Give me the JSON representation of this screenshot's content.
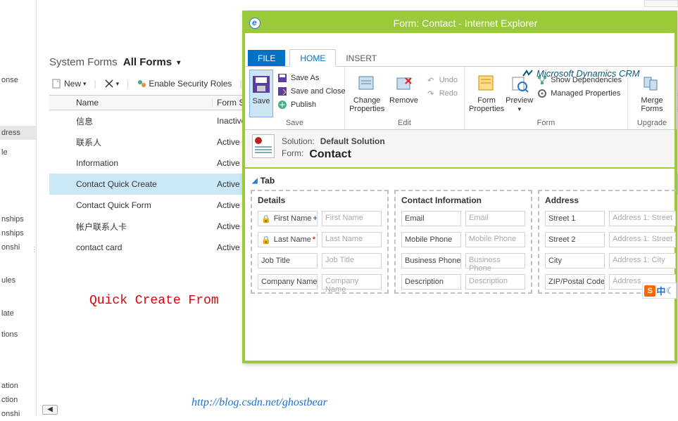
{
  "left_sidebar": {
    "items": [
      "onse",
      "dress",
      "le",
      "nships",
      "nships",
      "onshi",
      "ules",
      "late",
      "tions",
      "ation",
      "ction",
      "onshi"
    ]
  },
  "breadcrumb": {
    "label": "System Forms",
    "filter": "All Forms"
  },
  "toolbar": {
    "new_label": "New",
    "enable_security_label": "Enable Security Roles"
  },
  "grid": {
    "columns": {
      "name": "Name",
      "state": "Form S"
    },
    "rows": [
      {
        "name": "信息",
        "state": "Inactive"
      },
      {
        "name": "联系人",
        "state": "Active"
      },
      {
        "name": "Information",
        "state": "Active"
      },
      {
        "name": "Contact Quick Create",
        "state": "Active"
      },
      {
        "name": "Contact Quick Form",
        "state": "Active"
      },
      {
        "name": "帐户联系人卡",
        "state": "Active"
      },
      {
        "name": "contact card",
        "state": "Active"
      }
    ],
    "selected_index": 3
  },
  "annotation": "Quick Create From",
  "footer_link": "http://blog.csdn.net/ghostbear",
  "ie": {
    "title": "Form: Contact - Internet Explorer",
    "brand": "Microsoft Dynamics CRM",
    "tabs": {
      "file": "FILE",
      "home": "HOME",
      "insert": "INSERT"
    },
    "ribbon": {
      "save_group": "Save",
      "save": "Save",
      "save_as": "Save As",
      "save_close": "Save and Close",
      "publish": "Publish",
      "edit_group": "Edit",
      "change_props": "Change\nProperties",
      "remove": "Remove",
      "undo": "Undo",
      "redo": "Redo",
      "form_group": "Form",
      "form_props": "Form\nProperties",
      "preview": "Preview",
      "show_deps": "Show Dependencies",
      "managed_props": "Managed Properties",
      "upgrade_group": "Upgrade",
      "merge_forms": "Merge\nForms"
    },
    "info": {
      "solution_label": "Solution:",
      "solution_value": "Default Solution",
      "form_label": "Form:",
      "form_value": "Contact"
    },
    "form": {
      "tab_label": "Tab",
      "sections": [
        {
          "title": "Details",
          "fields": [
            {
              "label": "First Name",
              "lock": true,
              "plus": true,
              "placeholder": "First Name"
            },
            {
              "label": "Last Name",
              "lock": true,
              "star": true,
              "placeholder": "Last Name"
            },
            {
              "label": "Job Title",
              "placeholder": "Job Title"
            },
            {
              "label": "Company Name",
              "placeholder": "Company Name"
            }
          ]
        },
        {
          "title": "Contact Information",
          "fields": [
            {
              "label": "Email",
              "placeholder": "Email"
            },
            {
              "label": "Mobile Phone",
              "placeholder": "Mobile Phone"
            },
            {
              "label": "Business Phone",
              "placeholder": "Business Phone"
            },
            {
              "label": "Description",
              "placeholder": "Description"
            }
          ]
        },
        {
          "title": "Address",
          "fields": [
            {
              "label": "Street 1",
              "placeholder": "Address 1: Street"
            },
            {
              "label": "Street 2",
              "placeholder": "Address 1: Street"
            },
            {
              "label": "City",
              "placeholder": "Address 1: City"
            },
            {
              "label": "ZIP/Postal Code",
              "placeholder": "Address…"
            }
          ]
        }
      ]
    }
  },
  "ime": {
    "s": "S",
    "cn": "中",
    "moon": "☾"
  }
}
